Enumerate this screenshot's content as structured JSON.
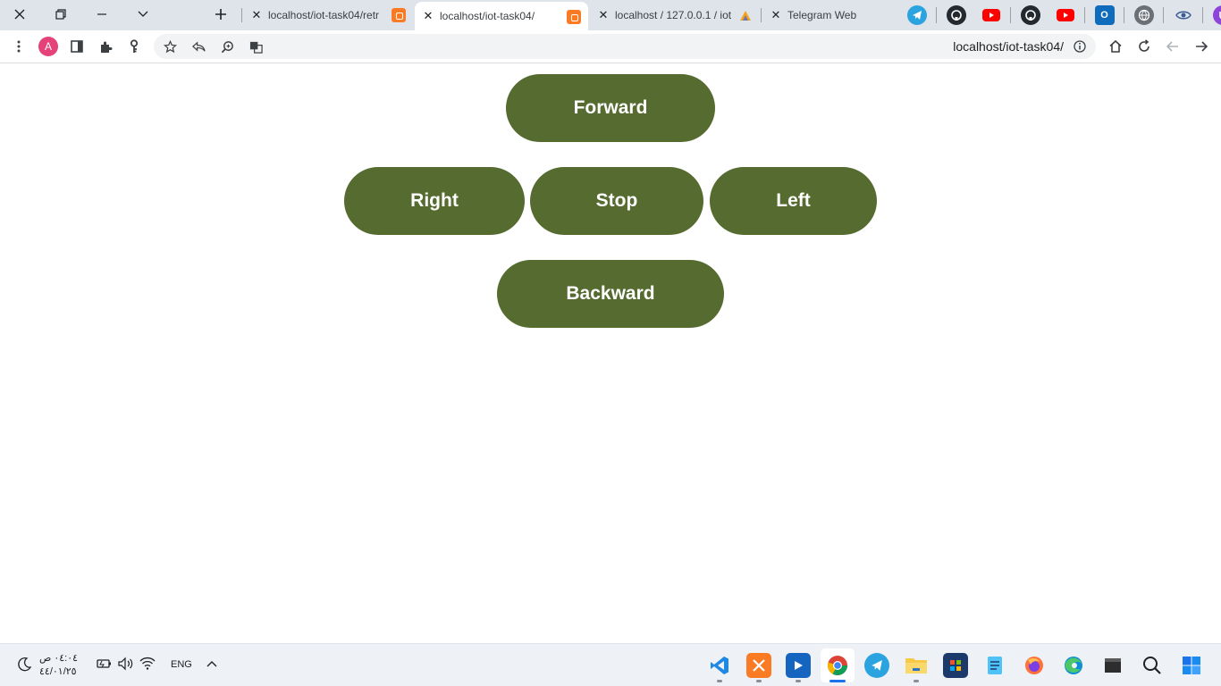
{
  "browser": {
    "tabs": [
      {
        "title": "localhost/iot-task04/retr",
        "favicon": "xampp-icon",
        "active": false
      },
      {
        "title": "localhost/iot-task04/",
        "favicon": "xampp-icon",
        "active": true
      },
      {
        "title": "localhost / 127.0.0.1 / iot",
        "favicon": "phpmyadmin-icon",
        "active": false
      },
      {
        "title": "Telegram Web",
        "favicon": "",
        "active": false
      }
    ],
    "address_bar": {
      "url": "localhost/iot-task04/"
    },
    "profile_initial": "A",
    "extensions": [
      "telegram-icon",
      "github-icon",
      "youtube-icon",
      "github-icon",
      "youtube-icon",
      "outlook-icon",
      "globe-icon",
      "eye-extension-icon",
      "purple-extension-icon"
    ]
  },
  "page": {
    "buttons": {
      "forward": "Forward",
      "right": "Right",
      "stop": "Stop",
      "left": "Left",
      "backward": "Backward"
    },
    "button_color": "#556b2f",
    "button_text_color": "#ffffff"
  },
  "taskbar": {
    "clock_time": "٠٤:٠٤ ص",
    "clock_date": "٤٤/٠١/٢٥",
    "language": "ENG",
    "apps": [
      "vscode-icon",
      "xampp-icon",
      "media-player-icon",
      "chrome-icon",
      "telegram-icon",
      "file-explorer-icon",
      "store-icon",
      "notepad-icon",
      "firefox-icon",
      "edge-icon",
      "terminal-icon",
      "search-icon",
      "start-icon"
    ]
  }
}
